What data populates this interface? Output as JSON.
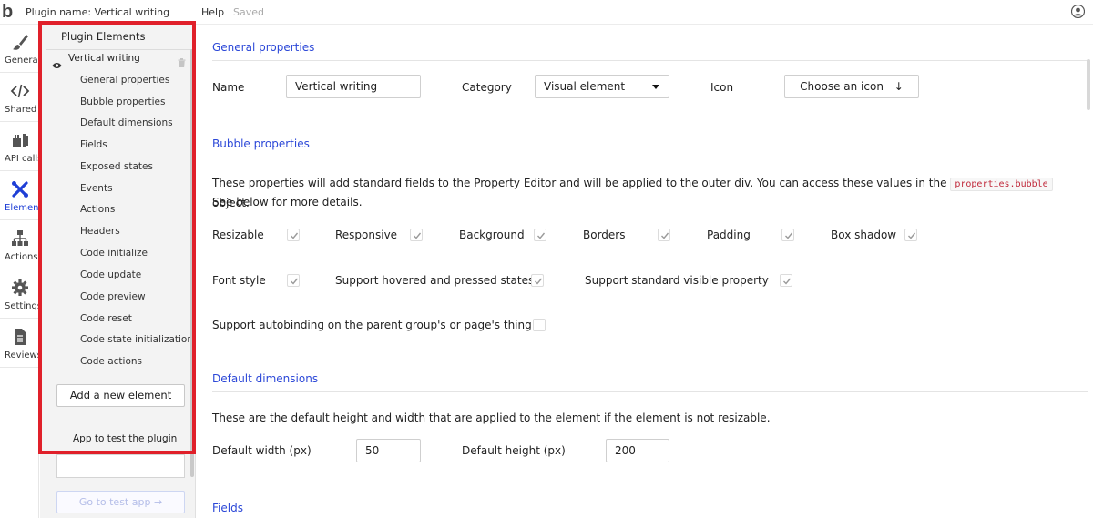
{
  "topbar": {
    "logo": "b",
    "plugin_name": "Plugin name: Vertical writing",
    "help": "Help",
    "saved": "Saved"
  },
  "rail": {
    "items": [
      {
        "label": "General",
        "icon": "brush-icon"
      },
      {
        "label": "Shared",
        "icon": "code-icon"
      },
      {
        "label": "API calls",
        "icon": "plug-icon"
      },
      {
        "label": "Elements",
        "icon": "elements-icon"
      },
      {
        "label": "Actions",
        "icon": "sitemap-icon"
      },
      {
        "label": "Settings",
        "icon": "gear-icon"
      },
      {
        "label": "Reviews",
        "icon": "document-icon"
      }
    ],
    "active_color": "#1f3fd6"
  },
  "panel": {
    "title": "Plugin Elements",
    "element_name": "Vertical writing",
    "sub_items": [
      "General properties",
      "Bubble properties",
      "Default dimensions",
      "Fields",
      "Exposed states",
      "Events",
      "Actions",
      "Headers",
      "Code initialize",
      "Code update",
      "Code preview",
      "Code reset",
      "Code state initialization",
      "Code actions"
    ],
    "add_button": "Add a new element",
    "app_to_test": "App to test the plugin",
    "go_button": "Go to test app →"
  },
  "main": {
    "general": {
      "title": "General properties",
      "name_label": "Name",
      "name_value": "Vertical writing",
      "category_label": "Category",
      "category_value": "Visual element",
      "icon_label": "Icon",
      "choose_icon": "Choose an icon",
      "choose_icon_arrow": "↓"
    },
    "bubble": {
      "title": "Bubble properties",
      "desc_before": "These properties will add standard fields to the Property Editor and will be applied to the outer div. You can access these values in the",
      "desc_code": "properties.bubble",
      "desc_after": "object.",
      "desc_line2": "See below for more details.",
      "resizable": "Resizable",
      "responsive": "Responsive",
      "background": "Background",
      "borders": "Borders",
      "padding": "Padding",
      "box_shadow": "Box shadow",
      "font_style": "Font style",
      "hovered": "Support hovered and pressed states",
      "visible": "Support standard visible property",
      "autobinding": "Support autobinding on the parent group's or page's thing"
    },
    "dimensions": {
      "title": "Default dimensions",
      "desc": "These are the default height and width that are applied to the element if the element is not resizable.",
      "width_label": "Default width (px)",
      "width_value": "50",
      "height_label": "Default height (px)",
      "height_value": "200"
    },
    "fields": {
      "title": "Fields"
    }
  }
}
